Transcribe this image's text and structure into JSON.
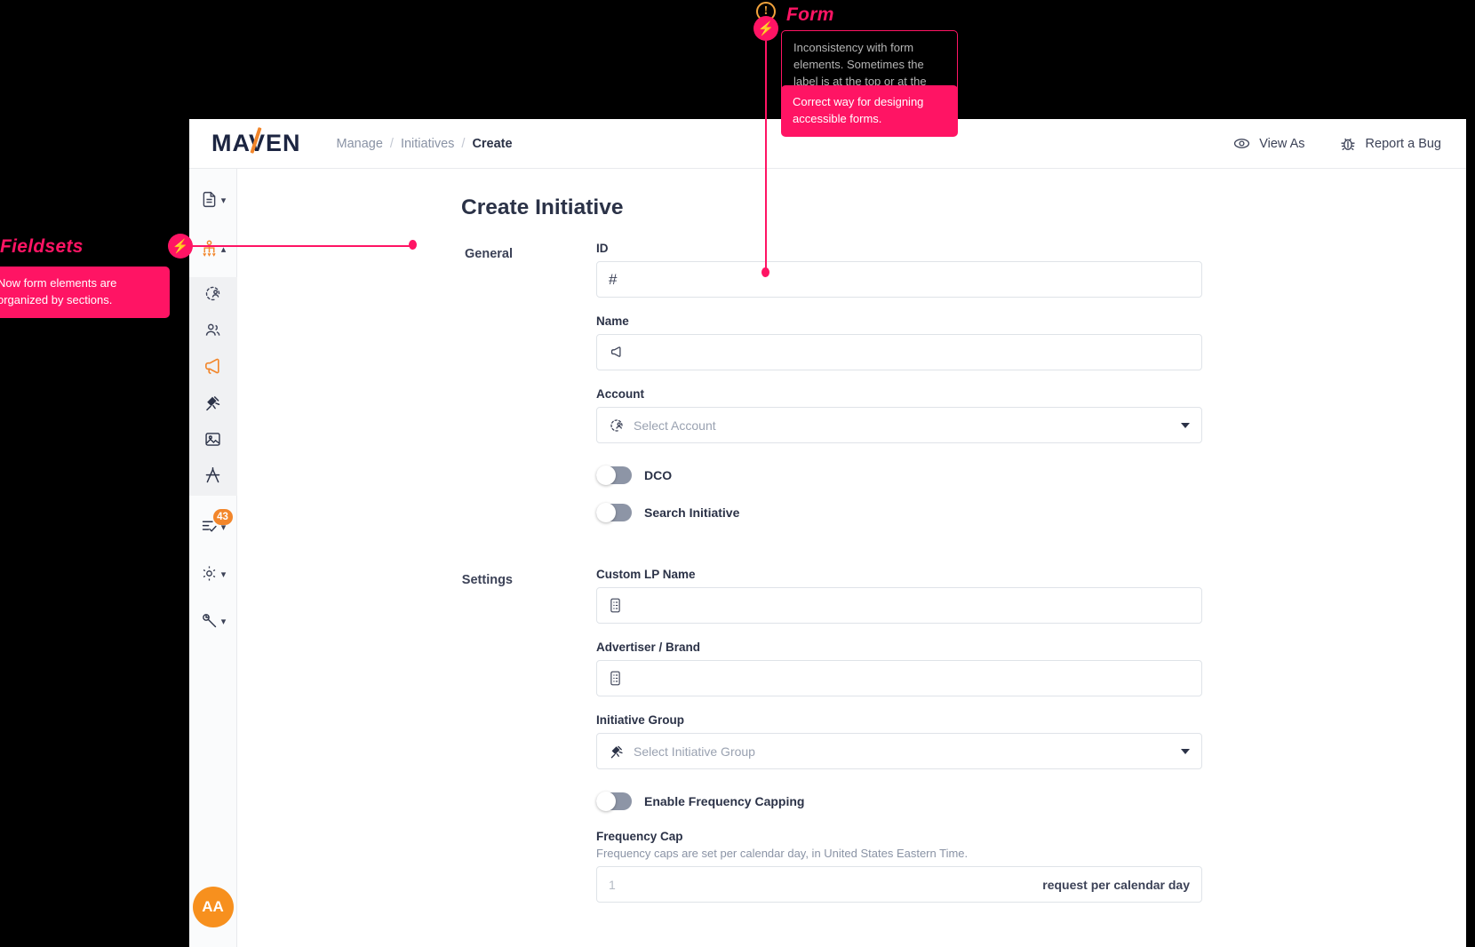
{
  "header": {
    "brand": "MAVEN",
    "breadcrumb": [
      "Manage",
      "Initiatives",
      "Create"
    ],
    "separator": "/",
    "view_as_label": "View As",
    "report_bug_label": "Report a Bug"
  },
  "sidebar": {
    "items": [
      {
        "name": "documents",
        "icon": "document-icon",
        "caret": "down",
        "badge": null,
        "accent": false
      },
      {
        "name": "initiatives",
        "icon": "initiatives-node-icon",
        "caret": "up",
        "badge": null,
        "accent": true
      },
      {
        "name": "accounts",
        "icon": "account-circle-icon",
        "caret": null,
        "badge": null,
        "accent": false
      },
      {
        "name": "audiences",
        "icon": "people-icon",
        "caret": null,
        "badge": null,
        "accent": false
      },
      {
        "name": "campaigns",
        "icon": "megaphone-icon",
        "caret": null,
        "badge": null,
        "accent": true
      },
      {
        "name": "initiative-group",
        "icon": "initiative-group-icon",
        "caret": null,
        "badge": null,
        "accent": false
      },
      {
        "name": "creatives",
        "icon": "image-icon",
        "caret": null,
        "badge": null,
        "accent": false
      },
      {
        "name": "design",
        "icon": "compass-icon",
        "caret": null,
        "badge": null,
        "accent": false
      },
      {
        "name": "tasks",
        "icon": "checklist-icon",
        "caret": "down",
        "badge": "43",
        "accent": false
      },
      {
        "name": "settings",
        "icon": "gear-icon",
        "caret": "down",
        "badge": null,
        "accent": false
      },
      {
        "name": "tools",
        "icon": "wrench-icon",
        "caret": "down",
        "badge": null,
        "accent": false
      }
    ],
    "avatar_initials": "AA"
  },
  "page": {
    "title": "Create Initiative"
  },
  "sections": [
    {
      "label": "General",
      "fields": [
        {
          "kind": "text",
          "name": "id",
          "label": "ID",
          "icon": "hash-icon",
          "value": "",
          "placeholder": ""
        },
        {
          "kind": "text",
          "name": "name",
          "label": "Name",
          "icon": "megaphone-icon",
          "value": "",
          "placeholder": ""
        },
        {
          "kind": "select",
          "name": "account",
          "label": "Account",
          "icon": "account-circle-icon",
          "value": "Select Account",
          "placeholder": "Select Account"
        },
        {
          "kind": "toggle",
          "name": "dco",
          "label": "DCO",
          "checked": false
        },
        {
          "kind": "toggle",
          "name": "search-initiative",
          "label": "Search Initiative",
          "checked": false
        }
      ]
    },
    {
      "label": "Settings",
      "fields": [
        {
          "kind": "text",
          "name": "custom-lp-name",
          "label": "Custom LP Name",
          "icon": "list-document-icon",
          "value": "",
          "placeholder": ""
        },
        {
          "kind": "text",
          "name": "advertiser-brand",
          "label": "Advertiser / Brand",
          "icon": "list-document-icon",
          "value": "",
          "placeholder": ""
        },
        {
          "kind": "select",
          "name": "initiative-group",
          "label": "Initiative Group",
          "icon": "initiative-group-icon",
          "value": "Select Initiative Group",
          "placeholder": "Select Initiative Group"
        },
        {
          "kind": "toggle",
          "name": "enable-frequency-capping",
          "label": "Enable Frequency Capping",
          "checked": false
        },
        {
          "kind": "number-suffix",
          "name": "frequency-cap",
          "label": "Frequency Cap",
          "help": "Frequency caps are set per calendar day, in United States Eastern Time.",
          "value": "1",
          "suffix": "request per calendar day"
        }
      ]
    }
  ],
  "annotations": {
    "form": {
      "title": "Form",
      "warning_glyph": "!",
      "bolt_glyph": "⚡",
      "problem_text": "Inconsistency with form elements. Sometimes the label is at the top or at the left.",
      "solution_text": "Correct way for designing accessible forms."
    },
    "fieldsets": {
      "title": "Fieldsets",
      "bolt_glyph": "⚡",
      "solution_text": "Now form elements are organized by sections."
    },
    "accent_color": "#ff1464",
    "warning_color": "#f2a33c"
  }
}
